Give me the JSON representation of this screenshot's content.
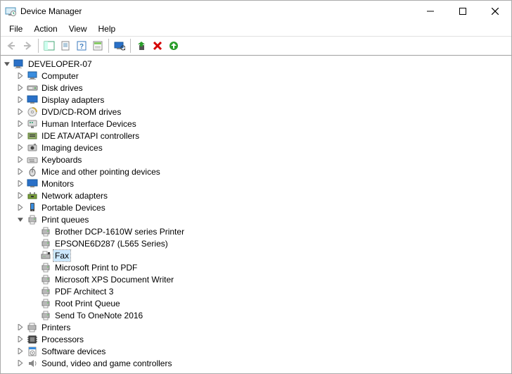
{
  "window": {
    "title": "Device Manager"
  },
  "menu": {
    "file": "File",
    "action": "Action",
    "view": "View",
    "help": "Help"
  },
  "tree": {
    "root": "DEVELOPER-07",
    "categories": [
      {
        "label": "Computer",
        "icon": "computer",
        "expanded": false
      },
      {
        "label": "Disk drives",
        "icon": "disk",
        "expanded": false
      },
      {
        "label": "Display adapters",
        "icon": "display",
        "expanded": false
      },
      {
        "label": "DVD/CD-ROM drives",
        "icon": "dvd",
        "expanded": false
      },
      {
        "label": "Human Interface Devices",
        "icon": "hid",
        "expanded": false
      },
      {
        "label": "IDE ATA/ATAPI controllers",
        "icon": "ide",
        "expanded": false
      },
      {
        "label": "Imaging devices",
        "icon": "imaging",
        "expanded": false
      },
      {
        "label": "Keyboards",
        "icon": "keyboard",
        "expanded": false
      },
      {
        "label": "Mice and other pointing devices",
        "icon": "mouse",
        "expanded": false
      },
      {
        "label": "Monitors",
        "icon": "monitor",
        "expanded": false
      },
      {
        "label": "Network adapters",
        "icon": "network",
        "expanded": false
      },
      {
        "label": "Portable Devices",
        "icon": "portable",
        "expanded": false
      },
      {
        "label": "Print queues",
        "icon": "printer",
        "expanded": true,
        "children": [
          {
            "label": "Brother DCP-1610W series Printer",
            "icon": "printer"
          },
          {
            "label": "EPSONE6D287 (L565 Series)",
            "icon": "printer"
          },
          {
            "label": "Fax",
            "icon": "fax",
            "selected": true
          },
          {
            "label": "Microsoft Print to PDF",
            "icon": "printer"
          },
          {
            "label": "Microsoft XPS Document Writer",
            "icon": "printer"
          },
          {
            "label": "PDF Architect 3",
            "icon": "printer"
          },
          {
            "label": "Root Print Queue",
            "icon": "printer"
          },
          {
            "label": "Send To OneNote 2016",
            "icon": "printer"
          }
        ]
      },
      {
        "label": "Printers",
        "icon": "printers-cat",
        "expanded": false
      },
      {
        "label": "Processors",
        "icon": "processor",
        "expanded": false
      },
      {
        "label": "Software devices",
        "icon": "software",
        "expanded": false
      },
      {
        "label": "Sound, video and game controllers",
        "icon": "sound",
        "expanded": false
      }
    ]
  }
}
